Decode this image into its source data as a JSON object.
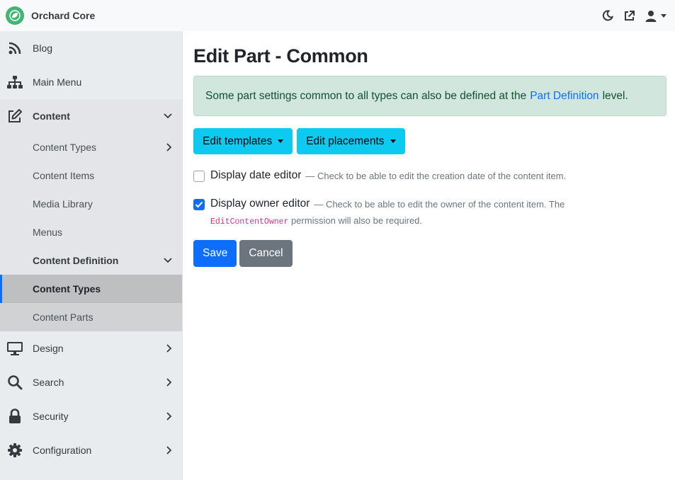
{
  "app": {
    "title": "Orchard Core"
  },
  "header": {
    "icons": [
      "moon-icon",
      "external-link-icon",
      "user-icon",
      "caret-down-icon"
    ]
  },
  "sidebar": {
    "items": [
      {
        "label": "Blog",
        "icon": "rss-icon"
      },
      {
        "label": "Main Menu",
        "icon": "sitemap-icon"
      },
      {
        "label": "Content",
        "icon": "edit-icon"
      },
      {
        "label": "Design",
        "icon": "desktop-icon"
      },
      {
        "label": "Search",
        "icon": "search-icon"
      },
      {
        "label": "Security",
        "icon": "lock-icon"
      },
      {
        "label": "Configuration",
        "icon": "cog-icon"
      }
    ],
    "content_sub": {
      "content_types": "Content Types",
      "content_items": "Content Items",
      "media_library": "Media Library",
      "menus": "Menus",
      "content_definition": "Content Definition",
      "def_types": "Content Types",
      "def_parts": "Content Parts"
    }
  },
  "main": {
    "title": "Edit Part - Common",
    "alert": {
      "prefix": "Some part settings common to all types can also be defined at the",
      "link": "Part Definition",
      "suffix": "level."
    },
    "buttons": {
      "edit_templates": "Edit templates",
      "edit_placements": "Edit placements"
    },
    "options": {
      "date_editor": {
        "label": "Display date editor",
        "hint": "— Check to be able to edit the creation date of the content item.",
        "checked": false
      },
      "owner_editor": {
        "label": "Display owner editor",
        "hint": "— Check to be able to edit the owner of the content item. The",
        "code": "EditContentOwner",
        "hint2": "permission will also be required.",
        "checked": true
      }
    },
    "save": "Save",
    "cancel": "Cancel"
  },
  "colors": {
    "primary": "#0d6efd",
    "info": "#0dcaf0",
    "success_bg": "#d1e7dd",
    "brand": "#41b670"
  }
}
